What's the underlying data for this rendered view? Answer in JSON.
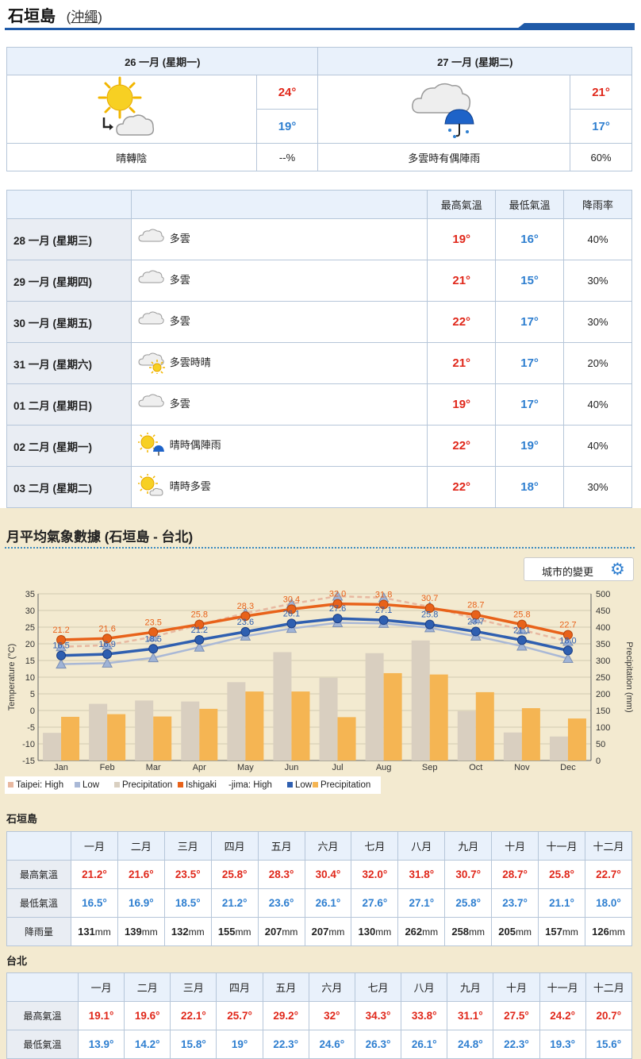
{
  "header": {
    "city": "石垣島",
    "region": "沖繩"
  },
  "today": {
    "days": [
      {
        "date": "26 一月 (星期一)",
        "high": "24°",
        "low": "19°",
        "condition": "晴轉陰",
        "rain": "--%",
        "icon": "sun-to-cloud-icon"
      },
      {
        "date": "27 一月 (星期二)",
        "high": "21°",
        "low": "17°",
        "condition": "多雲時有偶陣雨",
        "rain": "60%",
        "icon": "cloud-rain-icon"
      }
    ]
  },
  "forecast": {
    "headers": {
      "high": "最高氣溫",
      "low": "最低氣溫",
      "rain": "降雨率"
    },
    "rows": [
      {
        "date": "28 一月 (星期三)",
        "cond": "多雲",
        "icon": "cloud-icon",
        "high": "19°",
        "low": "16°",
        "rain": "40%"
      },
      {
        "date": "29 一月 (星期四)",
        "cond": "多雲",
        "icon": "cloud-icon",
        "high": "21°",
        "low": "15°",
        "rain": "30%"
      },
      {
        "date": "30 一月 (星期五)",
        "cond": "多雲",
        "icon": "cloud-icon",
        "high": "22°",
        "low": "17°",
        "rain": "30%"
      },
      {
        "date": "31 一月 (星期六)",
        "cond": "多雲時晴",
        "icon": "cloud-sun-icon",
        "high": "21°",
        "low": "17°",
        "rain": "20%"
      },
      {
        "date": "01 二月 (星期日)",
        "cond": "多雲",
        "icon": "cloud-icon",
        "high": "19°",
        "low": "17°",
        "rain": "40%"
      },
      {
        "date": "02 二月 (星期一)",
        "cond": "晴時偶陣雨",
        "icon": "sun-rain-icon",
        "high": "22°",
        "low": "19°",
        "rain": "40%"
      },
      {
        "date": "03 二月 (星期二)",
        "cond": "晴時多雲",
        "icon": "sun-cloud-icon",
        "high": "22°",
        "low": "18°",
        "rain": "30%"
      }
    ]
  },
  "monthly": {
    "title": "月平均氣象數據 (石垣島 - 台北)",
    "change_city": "城市的變更"
  },
  "chart_data": {
    "type": "line",
    "categories": [
      "Jan",
      "Feb",
      "Mar",
      "Apr",
      "May",
      "Jun",
      "Jul",
      "Aug",
      "Sep",
      "Oct",
      "Nov",
      "Dec"
    ],
    "ylabel": "Temperature (°C)",
    "y2label": "Precipitation (mm)",
    "ylim": [
      -15,
      35
    ],
    "y2lim": [
      0,
      500
    ],
    "yticks": [
      "35",
      "30",
      "25",
      "20",
      "15",
      "10",
      "5",
      "0",
      "-5",
      "-10",
      "-15"
    ],
    "y2ticks": [
      "500",
      "450",
      "400",
      "350",
      "300",
      "250",
      "200",
      "150",
      "100",
      "50",
      "0"
    ],
    "grid": true,
    "legend_position": "bottom-left",
    "legend": [
      "Taipei: High",
      "Low",
      "Precipitation",
      "Ishigaki",
      "-jima: High",
      "Low",
      "Precipitation"
    ],
    "series": [
      {
        "name": "Taipei: High",
        "kind": "line",
        "axis": "temp",
        "color": "#e8b8a0",
        "values": [
          19.1,
          19.6,
          22.1,
          25.7,
          29.2,
          32,
          34.3,
          33.8,
          31.1,
          27.5,
          24.2,
          20.7
        ]
      },
      {
        "name": "Taipei: Low",
        "kind": "line",
        "axis": "temp",
        "color": "#a9b8d6",
        "values": [
          13.9,
          14.2,
          15.8,
          19,
          22.3,
          24.6,
          26.3,
          26.1,
          24.8,
          22.3,
          19.3,
          15.6
        ]
      },
      {
        "name": "Taipei: Precipitation",
        "kind": "bar",
        "axis": "precip",
        "color": "#d9cfc0",
        "values": [
          83,
          170,
          180,
          177,
          235,
          325,
          248,
          322,
          360,
          148,
          84,
          72
        ]
      },
      {
        "name": "Ishigaki-jima: High",
        "kind": "line",
        "axis": "temp",
        "color": "#e8621a",
        "values": [
          21.2,
          21.6,
          23.5,
          25.8,
          28.3,
          30.4,
          32.0,
          31.8,
          30.7,
          28.7,
          25.8,
          22.7
        ]
      },
      {
        "name": "Ishigaki-jima: Low",
        "kind": "line",
        "axis": "temp",
        "color": "#2f5fb0",
        "values": [
          16.5,
          16.9,
          18.5,
          21.2,
          23.6,
          26.1,
          27.6,
          27.1,
          25.8,
          23.7,
          21.1,
          18.0
        ]
      },
      {
        "name": "Ishigaki-jima: Precipitation",
        "kind": "bar",
        "axis": "precip",
        "color": "#f5b553",
        "values": [
          131,
          139,
          132,
          155,
          207,
          207,
          130,
          262,
          258,
          205,
          157,
          126
        ]
      }
    ],
    "high_labels": [
      "21.2",
      "21.6",
      "23.5",
      "25.8",
      "28.3",
      "30.4",
      "32.0",
      "31.8",
      "30.7",
      "28.7",
      "25.8",
      "22.7"
    ],
    "low_labels": [
      "16.5",
      "16.9",
      "18.5",
      "21.2",
      "23.6",
      "26.1",
      "27.6",
      "27.1",
      "25.8",
      "23.7",
      "21.1",
      "18.0"
    ]
  },
  "ishigaki_table": {
    "title": "石垣島",
    "months": [
      "一月",
      "二月",
      "三月",
      "四月",
      "五月",
      "六月",
      "七月",
      "八月",
      "九月",
      "十月",
      "十一月",
      "十二月"
    ],
    "rows": [
      {
        "label": "最高氣溫",
        "kind": "hi",
        "values": [
          "21.2°",
          "21.6°",
          "23.5°",
          "25.8°",
          "28.3°",
          "30.4°",
          "32.0°",
          "31.8°",
          "30.7°",
          "28.7°",
          "25.8°",
          "22.7°"
        ]
      },
      {
        "label": "最低氣溫",
        "kind": "lo",
        "values": [
          "16.5°",
          "16.9°",
          "18.5°",
          "21.2°",
          "23.6°",
          "26.1°",
          "27.6°",
          "27.1°",
          "25.8°",
          "23.7°",
          "21.1°",
          "18.0°"
        ]
      },
      {
        "label": "降雨量",
        "kind": "pr",
        "unit": "mm",
        "values": [
          "131",
          "139",
          "132",
          "155",
          "207",
          "207",
          "130",
          "262",
          "258",
          "205",
          "157",
          "126"
        ]
      }
    ]
  },
  "taipei_table": {
    "title": "台北",
    "months": [
      "一月",
      "二月",
      "三月",
      "四月",
      "五月",
      "六月",
      "七月",
      "八月",
      "九月",
      "十月",
      "十一月",
      "十二月"
    ],
    "rows": [
      {
        "label": "最高氣溫",
        "kind": "hi",
        "values": [
          "19.1°",
          "19.6°",
          "22.1°",
          "25.7°",
          "29.2°",
          "32°",
          "34.3°",
          "33.8°",
          "31.1°",
          "27.5°",
          "24.2°",
          "20.7°"
        ]
      },
      {
        "label": "最低氣溫",
        "kind": "lo",
        "values": [
          "13.9°",
          "14.2°",
          "15.8°",
          "19°",
          "22.3°",
          "24.6°",
          "26.3°",
          "26.1°",
          "24.8°",
          "22.3°",
          "19.3°",
          "15.6°"
        ]
      }
    ]
  }
}
